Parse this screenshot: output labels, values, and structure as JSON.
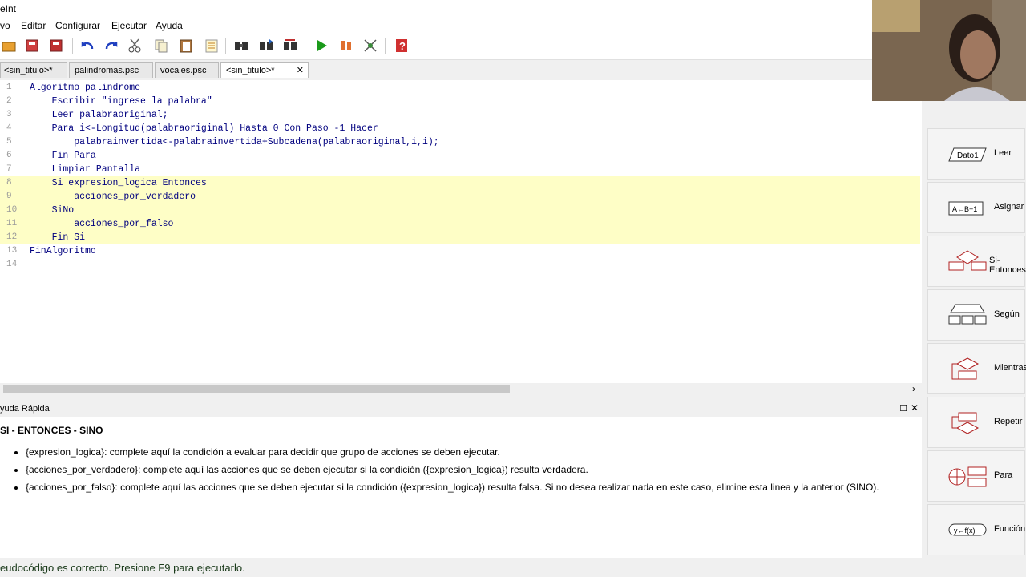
{
  "window": {
    "title": "eInt"
  },
  "menu": [
    "vo",
    "Editar",
    "Configurar",
    "Ejecutar",
    "Ayuda"
  ],
  "toolbar": {
    "icons": [
      "new-icon",
      "open-icon",
      "save-icon",
      "save-as-icon",
      "undo-icon",
      "redo-icon",
      "cut-icon",
      "copy-icon",
      "paste-icon",
      "indent-icon",
      "find-icon",
      "find-next-icon",
      "replace-icon",
      "run-icon",
      "step-icon",
      "draw-diagram-icon",
      "help-icon"
    ]
  },
  "tabs": [
    {
      "label": "<sin_titulo>*"
    },
    {
      "label": "palindromas.psc"
    },
    {
      "label": "vocales.psc"
    },
    {
      "label": "<sin_titulo>*",
      "close": "✕"
    }
  ],
  "editor": {
    "lines": [
      {
        "n": "1",
        "text": "Algoritmo palindrome"
      },
      {
        "n": "2",
        "text": "    Escribir \"ingrese la palabra\""
      },
      {
        "n": "3",
        "text": "    Leer palabraoriginal;"
      },
      {
        "n": "4",
        "text": "    Para i<-Longitud(palabraoriginal) Hasta 0 Con Paso -1 Hacer"
      },
      {
        "n": "5",
        "text": "        palabrainvertida<-palabrainvertida+Subcadena(palabraoriginal,i,i);"
      },
      {
        "n": "6",
        "text": "    Fin Para"
      },
      {
        "n": "7",
        "text": "    Limpiar Pantalla"
      },
      {
        "n": "8",
        "text": "    Si expresion_logica Entonces"
      },
      {
        "n": "9",
        "text": "        acciones_por_verdadero"
      },
      {
        "n": "10",
        "text": "    SiNo"
      },
      {
        "n": "11",
        "text": "        acciones_por_falso"
      },
      {
        "n": "12",
        "text": "    Fin Si"
      },
      {
        "n": "13",
        "text": "FinAlgoritmo"
      },
      {
        "n": "14",
        "text": ""
      }
    ]
  },
  "help": {
    "panel_title": "yuda Rápida",
    "heading": "SI - ENTONCES - SINO",
    "items": [
      "{expresion_logica}: complete aquí la condición a evaluar para decidir que grupo de acciones se deben ejecutar.",
      "{acciones_por_verdadero}: complete aquí las acciones que se deben ejecutar si la condición ({expresion_logica}) resulta verdadera.",
      "{acciones_por_falso}: complete aquí las acciones que se deben ejecutar si la condición ({expresion_logica}) resulta falsa. Si no desea realizar nada en este caso, elimine esta linea y la anterior (SINO)."
    ]
  },
  "status": "eudocódigo es correcto. Presione F9 para ejecutarlo.",
  "side_panel": [
    {
      "label": "Leer",
      "icon_text": "Dato1"
    },
    {
      "label": "Asignar",
      "icon_text": "A←B+1"
    },
    {
      "label": "Si-Entonces",
      "icon_text": ""
    },
    {
      "label": "Según",
      "icon_text": ""
    },
    {
      "label": "Mientras",
      "icon_text": ""
    },
    {
      "label": "Repetir",
      "icon_text": ""
    },
    {
      "label": "Para",
      "icon_text": ""
    },
    {
      "label": "Función",
      "icon_text": "y←f(x)"
    }
  ],
  "colors": {
    "highlight": "#fefec6",
    "keyword": "#00007f",
    "string": "#7f0000",
    "run": "#1a9a1a"
  }
}
